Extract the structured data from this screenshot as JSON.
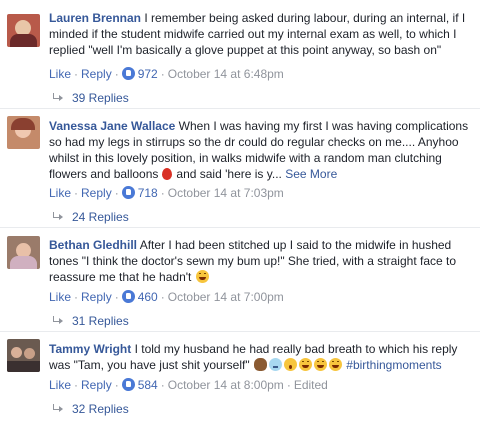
{
  "actions": {
    "like": "Like",
    "reply": "Reply"
  },
  "comments": [
    {
      "author": "Lauren Brennan",
      "text": "I remember being asked during labour, during an internal, if I minded if the student midwife carried out my internal exam as well, to which I replied \"well I'm basically a glove puppet at this point anyway, so bash on\"",
      "likes": "972",
      "timestamp": "October 14 at 6:48pm",
      "replies": "39 Replies",
      "avatar_color": "#b85a4a"
    },
    {
      "author": "Vanessa Jane Wallace",
      "text": "When I was having my first I was having complications so had my legs in stirrups so the dr could do regular checks on me.... Anyhoo whilst in this lovely position, in walks midwife with a random man clutching flowers and balloons",
      "text_tail": "and said 'here is y...",
      "see_more": "See More",
      "likes": "718",
      "timestamp": "October 14 at 7:03pm",
      "replies": "24 Replies",
      "avatar_color": "#c48a6a"
    },
    {
      "author": "Bethan Gledhill",
      "text": "After I had been stitched up I said to the midwife in hushed tones \"I think the doctor's sewn my bum up!\" She tried, with a straight face to reassure me that he hadn't",
      "likes": "460",
      "timestamp": "October 14 at 7:00pm",
      "replies": "31 Replies",
      "avatar_color": "#9a7b6a"
    },
    {
      "author": "Tammy Wright",
      "text": "I told my husband he had really bad breath to which his reply was \"Tam, you have just shit yourself\"",
      "hashtag": "#birthingmoments",
      "likes": "584",
      "timestamp": "October 14 at 8:00pm",
      "edited": "Edited",
      "replies": "32 Replies",
      "avatar_color": "#6a5a50"
    }
  ]
}
